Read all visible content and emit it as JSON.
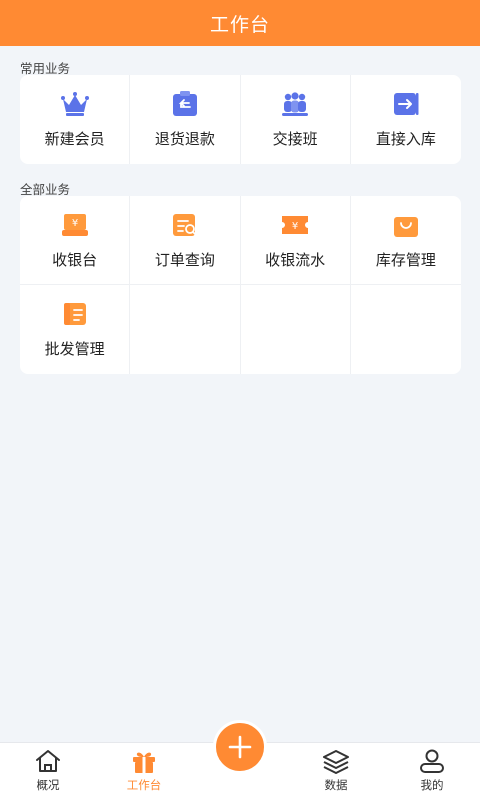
{
  "header": {
    "title": "工作台"
  },
  "common": {
    "label": "常用业务",
    "items": [
      {
        "label": "新建会员",
        "icon": "crown-icon"
      },
      {
        "label": "退货退款",
        "icon": "return-icon"
      },
      {
        "label": "交接班",
        "icon": "team-icon"
      },
      {
        "label": "直接入库",
        "icon": "stock-in-icon"
      }
    ]
  },
  "all": {
    "label": "全部业务",
    "items": [
      {
        "label": "收银台",
        "icon": "cashier-icon"
      },
      {
        "label": "订单查询",
        "icon": "order-search-icon"
      },
      {
        "label": "收银流水",
        "icon": "cash-flow-icon"
      },
      {
        "label": "库存管理",
        "icon": "inventory-bag-icon"
      },
      {
        "label": "批发管理",
        "icon": "wholesale-icon"
      }
    ]
  },
  "tabbar": {
    "items": [
      {
        "label": "概况",
        "icon": "home-icon"
      },
      {
        "label": "工作台",
        "icon": "gift-icon",
        "active": true
      },
      {
        "label": "",
        "icon": "plus-icon"
      },
      {
        "label": "数据",
        "icon": "layers-icon"
      },
      {
        "label": "我的",
        "icon": "user-icon"
      }
    ]
  },
  "colors": {
    "brand": "#ff8a33",
    "accent_blue": "#5b73e8",
    "background": "#f2f5f9"
  }
}
